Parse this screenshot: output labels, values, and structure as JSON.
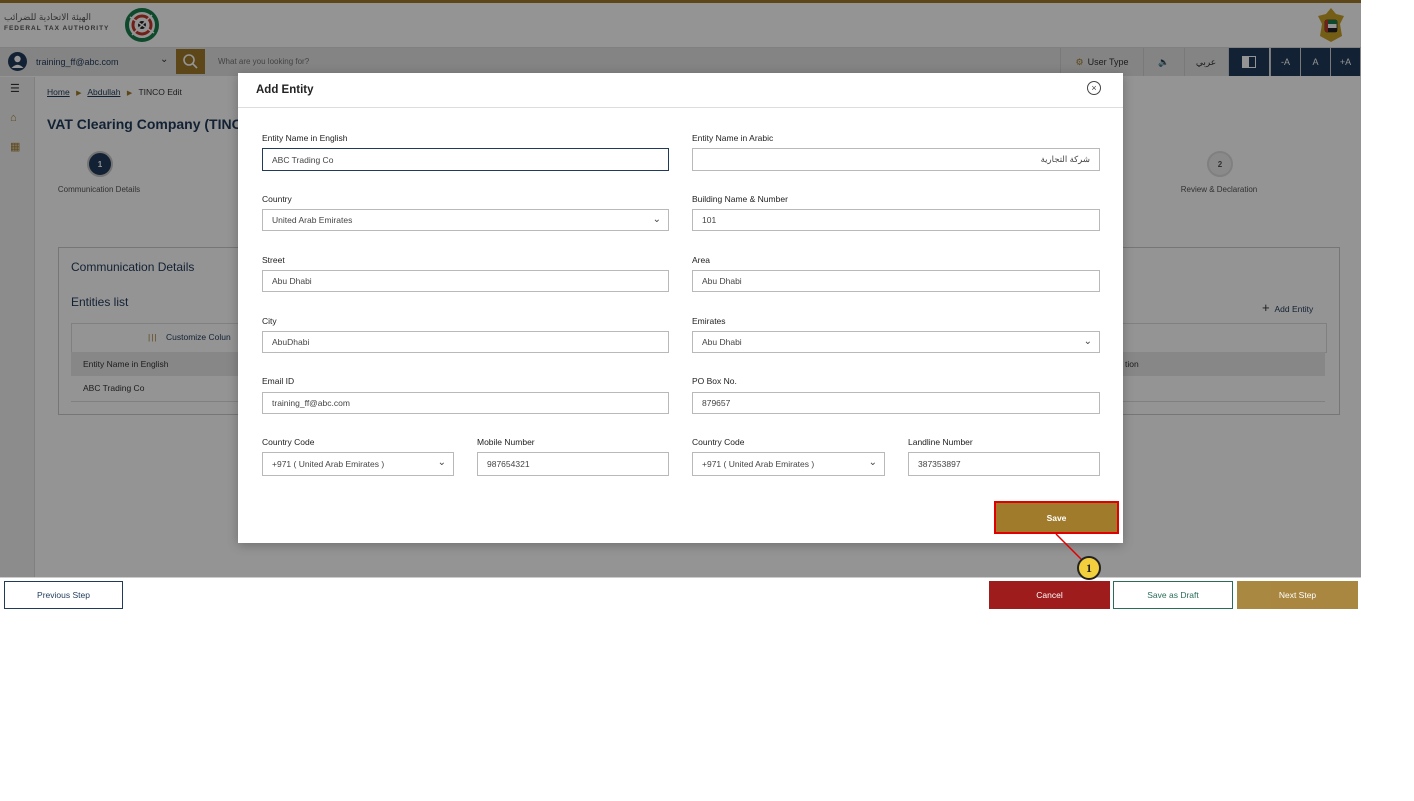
{
  "brand": {
    "name_ar": "الهيئة الاتحادية للضرائب",
    "name_en": "FEDERAL TAX AUTHORITY"
  },
  "top_nav": {
    "user_email": "training_ff@abc.com",
    "search_placeholder": "What are you looking for?",
    "user_type_label": "User Type",
    "language_label": "عربي",
    "font_decrease": "-A",
    "font_normal": "A",
    "font_increase": "+A"
  },
  "breadcrumb": {
    "home": "Home",
    "level2": "Abdullah",
    "current": "TINCO Edit"
  },
  "page": {
    "title": "VAT Clearing Company (TINC"
  },
  "steps": [
    {
      "number": "1",
      "label": "Communication Details"
    },
    {
      "number": "2",
      "label": "Review & Declaration"
    }
  ],
  "comm_section": {
    "title": "Communication Details",
    "entities_title": "Entities list",
    "add_entity_label": "Add Entity",
    "customize_label": "Customize Colun",
    "col_entity_name": "Entity Name in English",
    "col_action": "tion",
    "row_entity_name": "ABC Trading Co"
  },
  "modal": {
    "title": "Add Entity",
    "fields": {
      "entity_name_en": {
        "label": "Entity Name in English",
        "value": "ABC Trading Co"
      },
      "entity_name_ar": {
        "label": "Entity Name in Arabic",
        "value": "شركة التجارية"
      },
      "country": {
        "label": "Country",
        "value": "United Arab Emirates"
      },
      "building": {
        "label": "Building Name & Number",
        "value": "101"
      },
      "street": {
        "label": "Street",
        "value": "Abu Dhabi"
      },
      "area": {
        "label": "Area",
        "value": "Abu Dhabi"
      },
      "city": {
        "label": "City",
        "value": "AbuDhabi"
      },
      "emirates": {
        "label": "Emirates",
        "value": "Abu Dhabi"
      },
      "email": {
        "label": "Email ID",
        "value": "training_ff@abc.com"
      },
      "po_box": {
        "label": "PO Box No.",
        "value": "879657"
      },
      "mobile_country_code": {
        "label": "Country Code",
        "value": "+971 ( United Arab Emirates )"
      },
      "mobile_number": {
        "label": "Mobile Number",
        "value": "987654321"
      },
      "landline_country_code": {
        "label": "Country Code",
        "value": "+971 ( United Arab Emirates )"
      },
      "landline_number": {
        "label": "Landline Number",
        "value": "387353897"
      }
    },
    "save_label": "Save"
  },
  "footer": {
    "previous_label": "Previous Step",
    "cancel_label": "Cancel",
    "draft_label": "Save as Draft",
    "next_label": "Next Step"
  },
  "annotation": {
    "callout_number": "1"
  },
  "colors": {
    "brand_gold": "#a07b2c",
    "navy": "#1f3a5a",
    "cancel_red": "#9e1c1c",
    "highlight_red": "#e00000",
    "callout_yellow": "#f2cf3d"
  }
}
